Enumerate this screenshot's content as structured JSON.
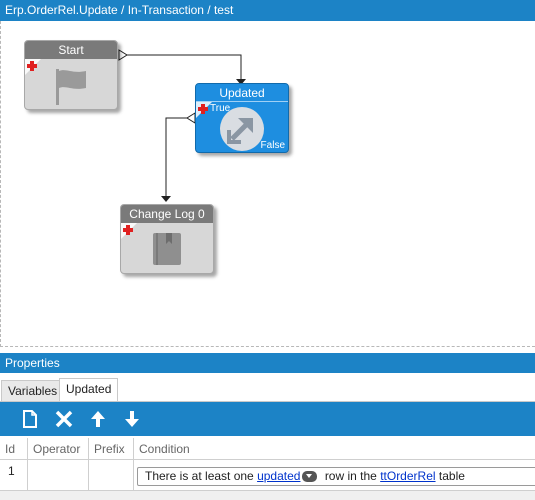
{
  "window": {
    "title": "Erp.OrderRel.Update / In-Transaction / test"
  },
  "canvas": {
    "nodes": {
      "start": {
        "label": "Start",
        "icon": "flag-icon"
      },
      "updated": {
        "label": "Updated",
        "true_label": "True",
        "false_label": "False",
        "icon": "diagonal-arrow-icon"
      },
      "change_log": {
        "label": "Change Log 0",
        "icon": "book-icon"
      }
    }
  },
  "properties": {
    "title": "Properties",
    "tabs": [
      {
        "label": "Variables",
        "active": false
      },
      {
        "label": "Updated",
        "active": true
      }
    ],
    "toolbar": {
      "buttons": [
        "new-document-icon",
        "delete-x-icon",
        "move-up-icon",
        "move-down-icon"
      ]
    },
    "grid": {
      "columns": [
        "Id",
        "Operator",
        "Prefix",
        "Condition"
      ],
      "rows": [
        {
          "id": "1",
          "operator": "",
          "prefix": "",
          "condition": {
            "text_1": "There is at least one",
            "link_1": "updated",
            "text_2": "row in the",
            "link_2": "ttOrderRel",
            "text_3": "table"
          }
        }
      ]
    }
  },
  "colors": {
    "accent": "#1c83c6",
    "selected_node": "#1e8ee0",
    "node_gray": "#d7d7d7",
    "node_header": "#7a7a7a"
  }
}
